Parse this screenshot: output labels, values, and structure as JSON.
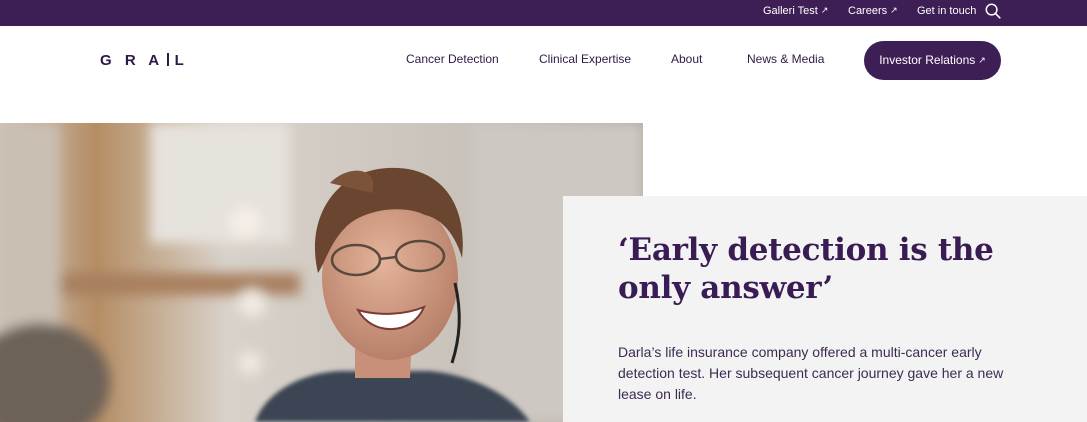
{
  "topbar": {
    "links": [
      "Galleri Test",
      "Careers",
      "Get in touch"
    ],
    "external_arrow": "↗"
  },
  "nav": {
    "logo": "GRAIL",
    "items": [
      "Cancer Detection",
      "Clinical Expertise",
      "About",
      "News & Media"
    ],
    "cta": "Investor Relations"
  },
  "hero": {
    "quote": "‘Early detection is the only answer’",
    "story": "Darla’s life insurance company offered a multi-cancer early detection test. Her subsequent cancer journey gave her a new lease on life."
  },
  "colors": {
    "brand_purple": "#3d1f55",
    "heading_purple": "#3a1c55",
    "card_bg": "#f3f3f3"
  }
}
